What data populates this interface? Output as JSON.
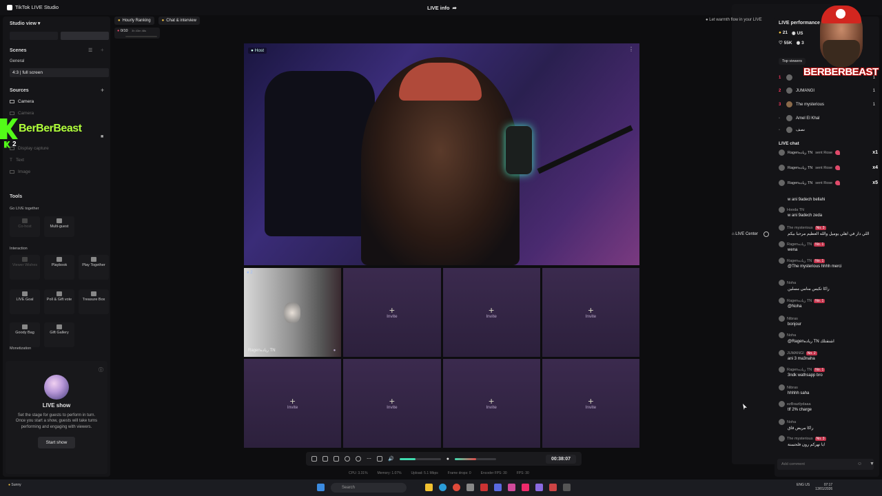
{
  "app": {
    "title": "TikTok LIVE Studio"
  },
  "topbar": {
    "live_info": "LIVE info",
    "live_center": "LIVE Center",
    "notif_count": "1"
  },
  "left": {
    "view_title": "Studio view",
    "scenes_title": "Scenes",
    "scenes_group": "General",
    "scene_item": "4:3 | full screen",
    "sources_title": "Sources",
    "sources": [
      "Camera",
      "Camera",
      "Display capture",
      "Text",
      "Image"
    ],
    "tools_title": "Tools",
    "go_live_together": "Go LIVE together",
    "co_host": "Co-host",
    "multi_guest": "Multi-guest",
    "interaction": "Interaction",
    "viewer_wishes": "Viewer Wishes",
    "playbook": "Playbook",
    "play_together": "Play Together",
    "live_goal": "LIVE Goal",
    "poll_gift": "Poll & Gift vote",
    "treasure_box": "Treasure Box",
    "goody_bag": "Goody Bag",
    "gift_gallery": "Gift Gallery",
    "monetization": "Monetization",
    "liveshow_title": "LIVE show",
    "liveshow_desc": "Set the stage for guests to perform in turn. Once you start a show, guests will take turns performing and engaging with viewers.",
    "start_show": "Start show"
  },
  "overlay": {
    "brand": "BerBerBeast",
    "count": "2"
  },
  "ranking": {
    "hourly": "Hourly Ranking",
    "chat": "Chat & interview",
    "progress": "0/10",
    "time_left": "3h 43m 48s"
  },
  "warmth": "Let warmth flow in your LIVE",
  "stage": {
    "host_label": "Host",
    "guest_num": "2",
    "guest_name": "Ragenرياده TN",
    "invite": "Invite"
  },
  "controls": {
    "timer": "00:38:07",
    "mic_level": 0.38,
    "vol_level": 0.52
  },
  "stats": {
    "cpu": "CPU: 3.31%",
    "memory": "Memory: 1.07%",
    "upload": "Upload: 5.1 Mbps",
    "frame_drops": "Frame drops: 0",
    "encoder": "Encoder FPS: 30",
    "fps": "FPS: 30"
  },
  "right": {
    "title": "LIVE performance",
    "stat1": "21",
    "stat2": "US",
    "stat3": "55K",
    "stat4": "3",
    "top_viewers": "Top viewers",
    "viewers": [
      {
        "rank": "1",
        "name": "",
        "count": "1"
      },
      {
        "rank": "2",
        "name": "JUMANGI",
        "count": "1"
      },
      {
        "rank": "3",
        "name": "The mysterious",
        "count": "1"
      },
      {
        "rank": "-",
        "name": "Amel El Khal",
        "count": ""
      },
      {
        "rank": "-",
        "name": "نصف",
        "count": ""
      }
    ],
    "live_chat": "LIVE chat",
    "gifts": [
      {
        "name": "Ragenرياده TN",
        "action": "sent Rose",
        "mult": "x1"
      },
      {
        "name": "Ragenرياده TN",
        "action": "sent Rose",
        "mult": "x4"
      },
      {
        "name": "Ragenرياده TN",
        "action": "sent Rose",
        "mult": "x5"
      }
    ],
    "messages": [
      {
        "user": "",
        "badge": "",
        "text": "w ani 9adech bellahi"
      },
      {
        "user": "Hooda TN",
        "badge": "",
        "text": "w ani 9adech zeda"
      },
      {
        "user": "The mysterious",
        "badge": "No. 3",
        "text": "اللي دار في اهلي يوميل والله العظيم مرحبا بيكم"
      },
      {
        "user": "Ragenرياده TN",
        "badge": "No. 1",
        "text": "wena"
      },
      {
        "user": "Ragenرياده TN",
        "badge": "No. 1",
        "text": "@The mysterious hhhh merci"
      },
      {
        "user": "Noha",
        "badge": "",
        "text": "راكا تكيس منامي مسلين"
      },
      {
        "user": "Ragenرياده TN",
        "badge": "No. 1",
        "text": "@Noha"
      },
      {
        "user": "Nibras",
        "badge": "",
        "text": "bonjour"
      },
      {
        "user": "Noha",
        "badge": "",
        "text": "@Ragenرياده TN اشتقتلك"
      },
      {
        "user": "JUMANGI",
        "badge": "No. 2",
        "text": "ani 3 ma3naha"
      },
      {
        "user": "Ragenرياده TN",
        "badge": "No. 1",
        "text": "3ndk wathsapp bro"
      },
      {
        "user": "Nibras",
        "badge": "",
        "text": "hhhhh saha"
      },
      {
        "user": "ezBrazilydaaa",
        "badge": "",
        "text": "tlf 2% charge"
      },
      {
        "user": "Noha",
        "badge": "",
        "text": "راكا مريض قاق"
      },
      {
        "user": "The mysterious",
        "badge": "No. 3",
        "text": "ايا نهركم رون فلحسنة"
      }
    ],
    "add_comment": "Add comment"
  },
  "profile": {
    "name": "BERBERBEAST"
  },
  "taskbar": {
    "weather": "Sunny",
    "search": "Search",
    "lang": "ENG US",
    "time": "07:17",
    "date": "13/01/2026"
  }
}
